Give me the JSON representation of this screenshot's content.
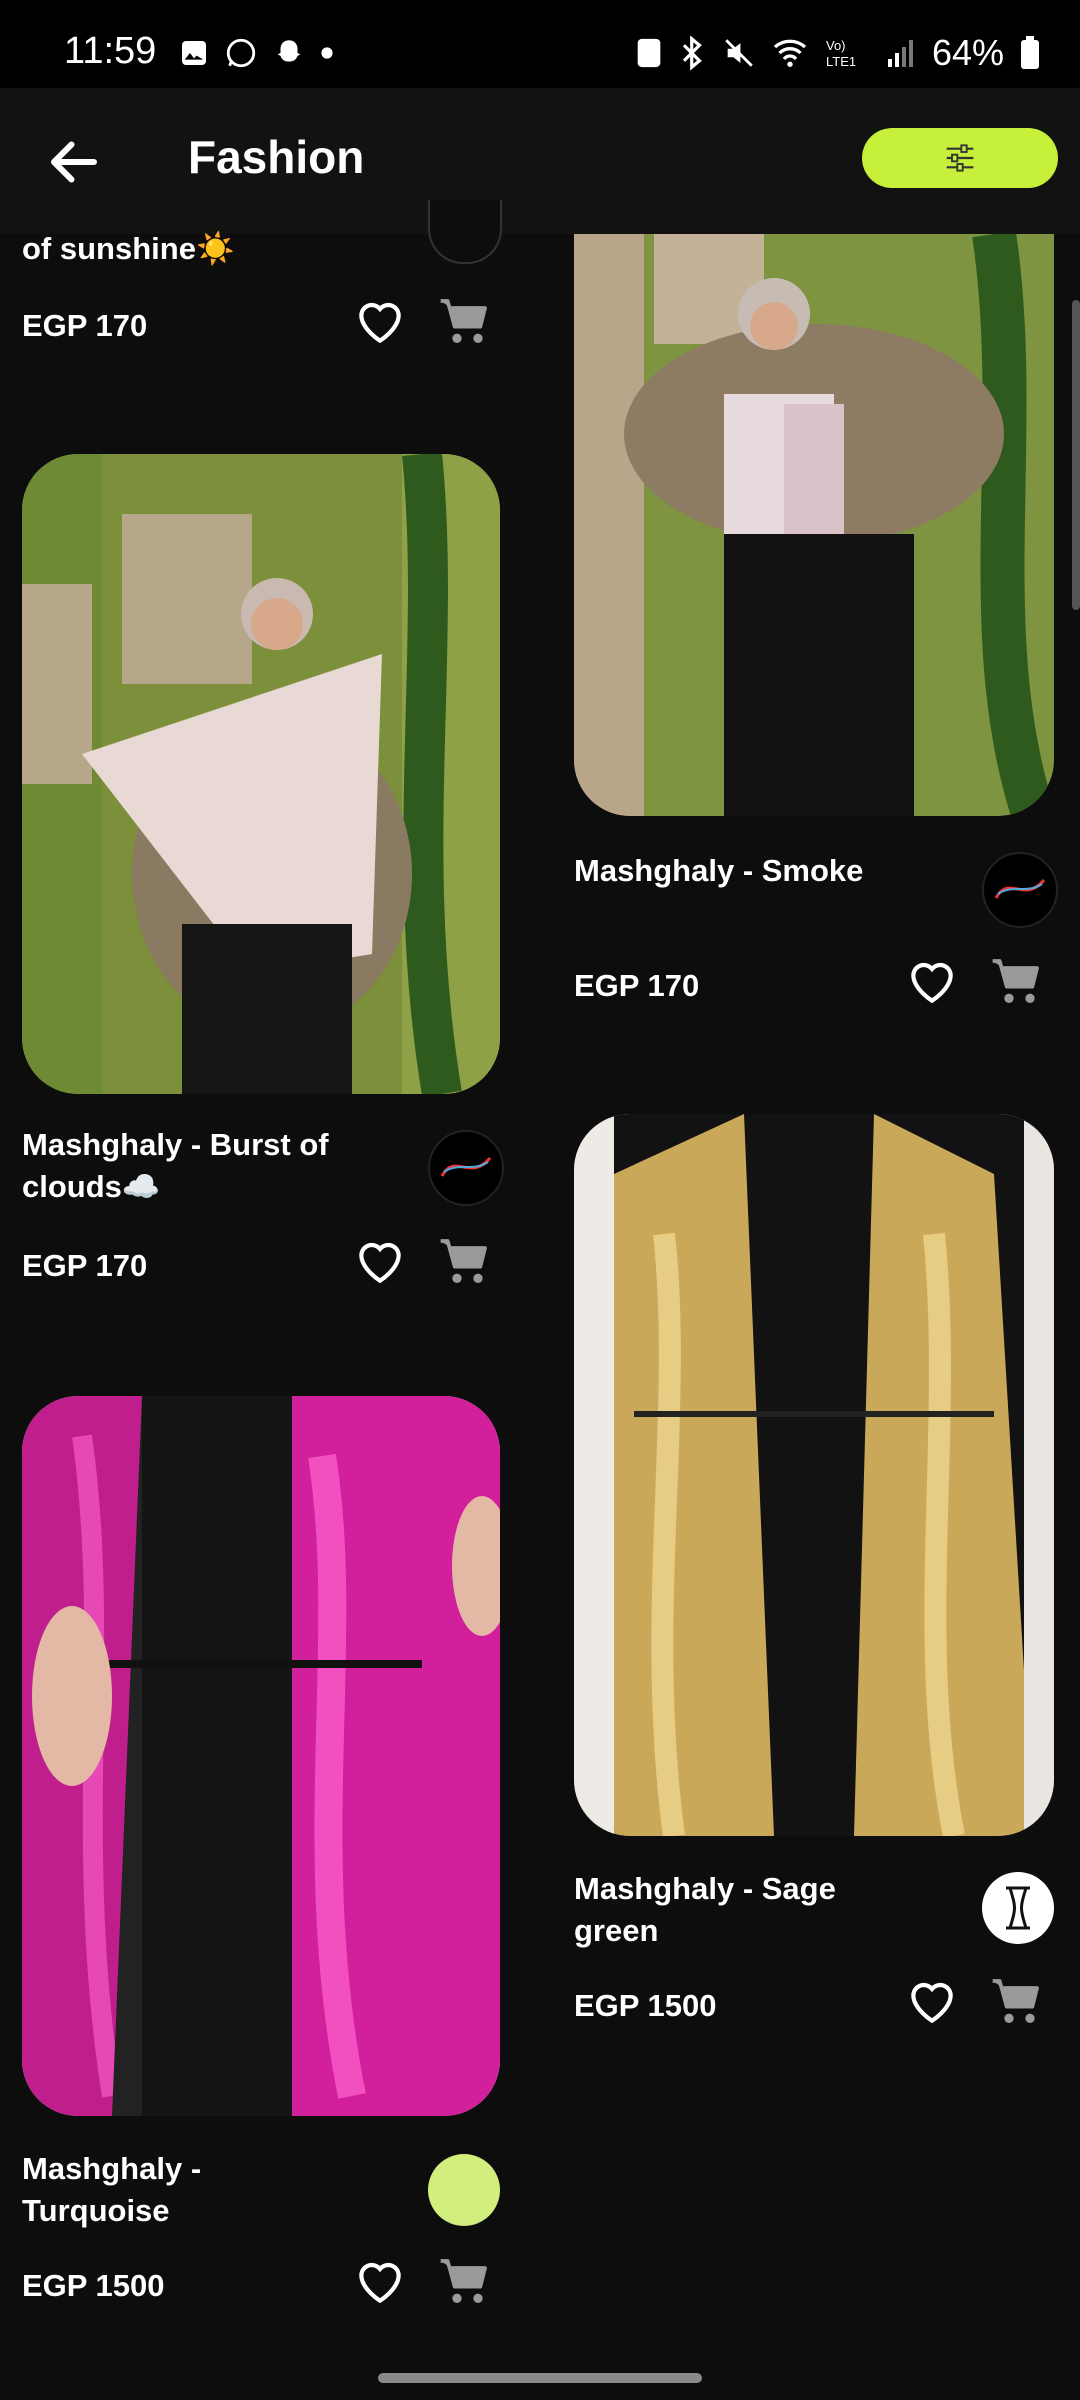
{
  "status": {
    "time": "11:59",
    "battery": "64%"
  },
  "header": {
    "title": "Fashion"
  },
  "colors": {
    "accent": "#c7f03a",
    "background": "#0d0d0d"
  },
  "products": [
    {
      "name": "of sunshine☀️",
      "price": "EGP 170"
    },
    {
      "name": "Mashghaly - Burst of clouds☁️",
      "price": "EGP 170"
    },
    {
      "name": "Mashghaly - Turquoise",
      "price": "EGP 1500"
    },
    {
      "name": "Mashghaly - Smoke",
      "price": "EGP 170"
    },
    {
      "name": "Mashghaly - Sage green",
      "price": "EGP 1500"
    }
  ]
}
